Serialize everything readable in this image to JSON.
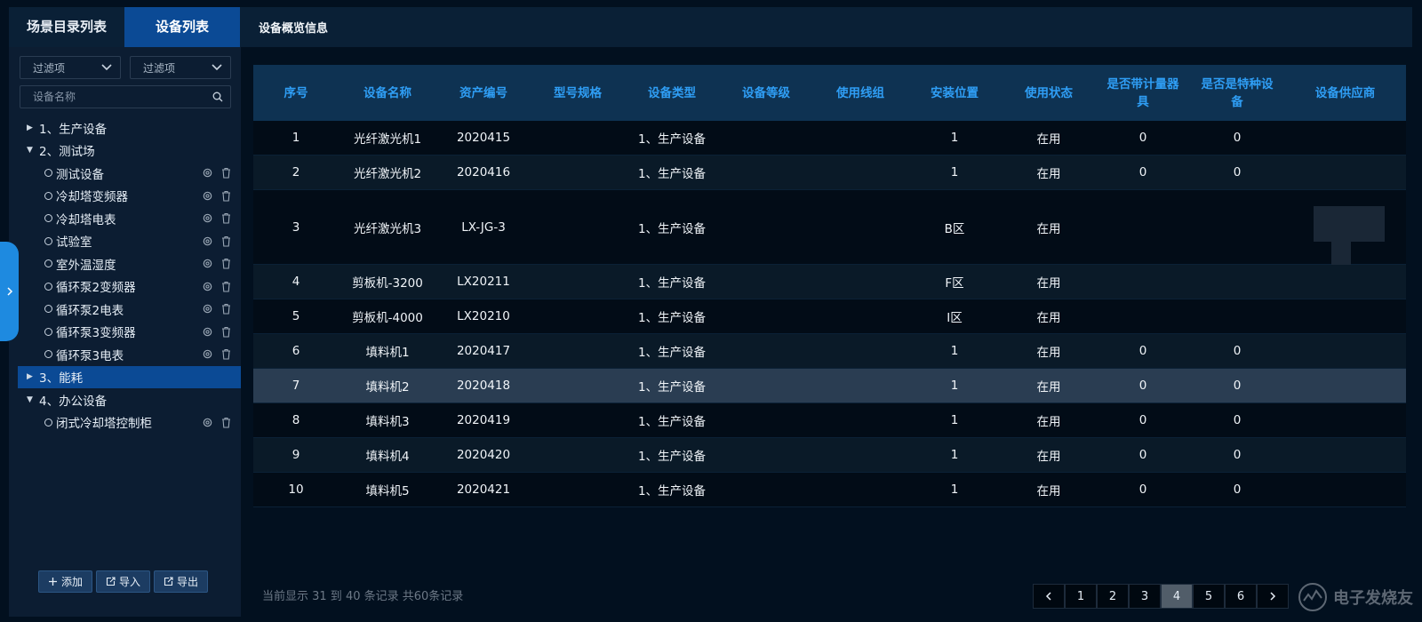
{
  "left_tabs": [
    "场景目录列表",
    "设备列表"
  ],
  "top_bar": {
    "title": "设备概览信息"
  },
  "filters": [
    {
      "placeholder": "过滤项"
    },
    {
      "placeholder": "过滤项"
    }
  ],
  "search": {
    "placeholder": "设备名称"
  },
  "tree": {
    "cat1": "1、生产设备",
    "cat2": "2、测试场",
    "cat2_children": [
      "测试设备",
      "冷却塔变频器",
      "冷却塔电表",
      "试验室",
      "室外温湿度",
      "循环泵2变频器",
      "循环泵2电表",
      "循环泵3变频器",
      "循环泵3电表"
    ],
    "cat3": "3、能耗",
    "cat4": "4、办公设备",
    "cat4_children": [
      "闭式冷却塔控制柜"
    ]
  },
  "left_buttons": {
    "add": "添加",
    "import": "导入",
    "export": "导出"
  },
  "table": {
    "headers": [
      "序号",
      "设备名称",
      "资产编号",
      "型号规格",
      "设备类型",
      "设备等级",
      "使用线组",
      "安装位置",
      "使用状态",
      "是否带计量器具",
      "是否是特种设备",
      "设备供应商"
    ],
    "rows": [
      [
        "1",
        "光纤激光机1",
        "2020415",
        "",
        "1、生产设备",
        "",
        "",
        "1",
        "在用",
        "0",
        "0",
        ""
      ],
      [
        "2",
        "光纤激光机2",
        "2020416",
        "",
        "1、生产设备",
        "",
        "",
        "1",
        "在用",
        "0",
        "0",
        ""
      ],
      [
        "3",
        "光纤激光机3",
        "LX-JG-3",
        "",
        "1、生产设备",
        "",
        "",
        "B区",
        "在用",
        "",
        "",
        ""
      ],
      [
        "4",
        "剪板机-3200",
        "LX20211",
        "",
        "1、生产设备",
        "",
        "",
        "F区",
        "在用",
        "",
        "",
        ""
      ],
      [
        "5",
        "剪板机-4000",
        "LX20210",
        "",
        "1、生产设备",
        "",
        "",
        "I区",
        "在用",
        "",
        "",
        ""
      ],
      [
        "6",
        "填料机1",
        "2020417",
        "",
        "1、生产设备",
        "",
        "",
        "1",
        "在用",
        "0",
        "0",
        ""
      ],
      [
        "7",
        "填料机2",
        "2020418",
        "",
        "1、生产设备",
        "",
        "",
        "1",
        "在用",
        "0",
        "0",
        ""
      ],
      [
        "8",
        "填料机3",
        "2020419",
        "",
        "1、生产设备",
        "",
        "",
        "1",
        "在用",
        "0",
        "0",
        ""
      ],
      [
        "9",
        "填料机4",
        "2020420",
        "",
        "1、生产设备",
        "",
        "",
        "1",
        "在用",
        "0",
        "0",
        ""
      ],
      [
        "10",
        "填料机5",
        "2020421",
        "",
        "1、生产设备",
        "",
        "",
        "1",
        "在用",
        "0",
        "0",
        ""
      ]
    ]
  },
  "record_info": "当前显示 31 到 40 条记录 共60条记录",
  "pagination": {
    "pages": [
      "1",
      "2",
      "3",
      "4",
      "5",
      "6"
    ],
    "current": "4"
  },
  "watermark": {
    "text": "电子发烧友"
  },
  "colors": {
    "accent": "#0b4a95",
    "header_text": "#2f9ef5",
    "collapse_tab": "#1e8ae0"
  }
}
